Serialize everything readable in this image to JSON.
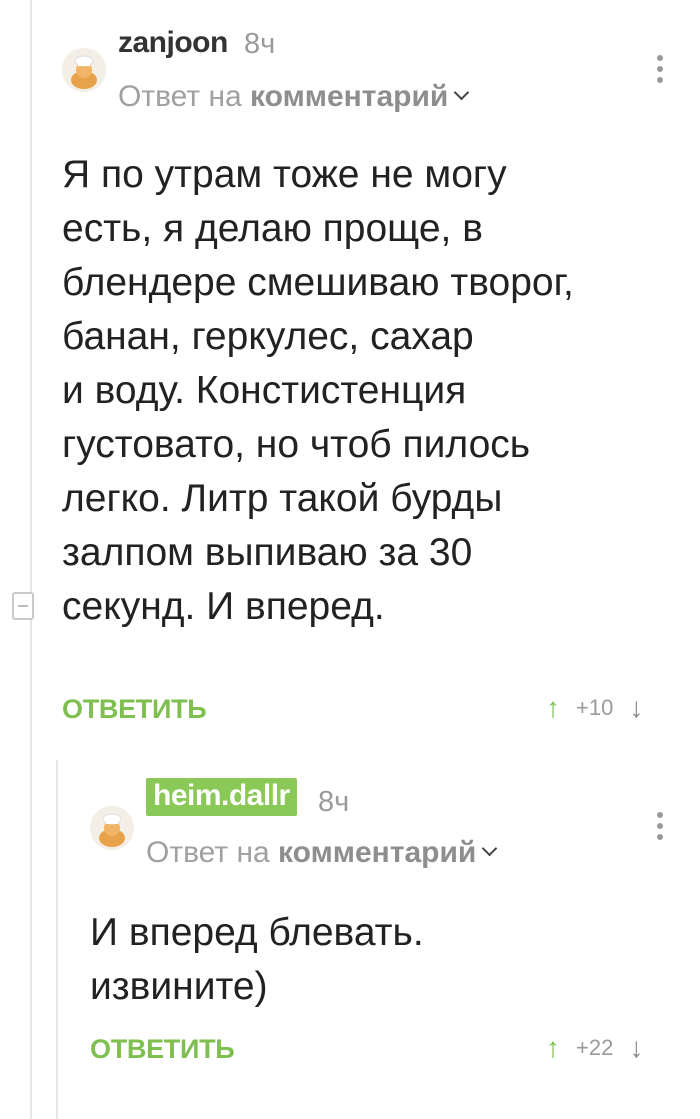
{
  "comments": [
    {
      "author": "zanjoon",
      "time": "8ч",
      "reply_prefix": "Ответ на",
      "reply_target": "комментарий",
      "text": "Я по утрам тоже не могу\nесть, я делаю проще, в\nблендере смешиваю творог,\nбанан, геркулес, сахар\nи воду. Констистенция\nгустовато, но чтоб пилось\nлегко. Литр такой бурды\nзалпом выпиваю за 30\nсекунд. И вперед.",
      "reply_label": "ОТВЕТИТЬ",
      "rating": "+10",
      "upvote_icon": "arrow-up-icon",
      "downvote_icon": "arrow-down-icon"
    },
    {
      "author": "heim.dallr",
      "time": "8ч",
      "reply_prefix": "Ответ на",
      "reply_target": "комментарий",
      "text": "И вперед блевать.\nизвините)",
      "reply_label": "ОТВЕТИТЬ",
      "rating": "+22",
      "upvote_icon": "arrow-up-icon",
      "downvote_icon": "arrow-down-icon"
    }
  ],
  "colors": {
    "accent_green": "#7fbf4f",
    "highlight_author_bg": "#8ac858",
    "muted_text": "#9a9a9a"
  }
}
